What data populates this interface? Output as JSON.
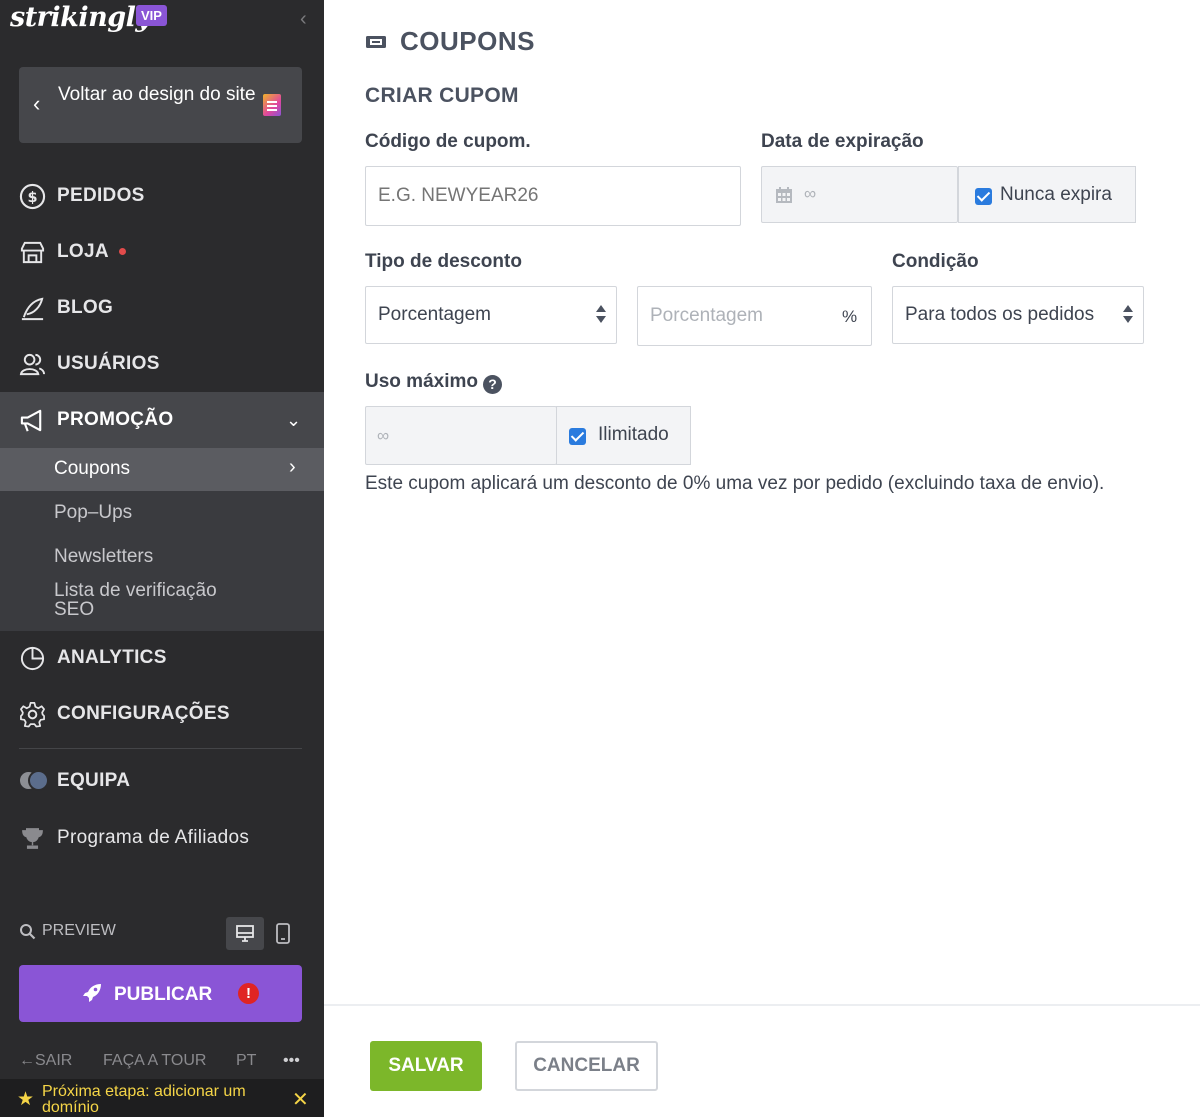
{
  "brand": {
    "logo": "strikingly",
    "badge": "VIP",
    "accent": "#8a55d6"
  },
  "sidebar": {
    "back_label": "Voltar ao design do site",
    "items": [
      {
        "label": "PEDIDOS",
        "icon": "dollar-circle-icon"
      },
      {
        "label": "LOJA",
        "icon": "store-icon"
      },
      {
        "label": "BLOG",
        "icon": "feather-pen-icon"
      },
      {
        "label": "USUÁRIOS",
        "icon": "users-icon"
      },
      {
        "label": "PROMOÇÃO",
        "icon": "megaphone-icon"
      },
      {
        "label": "ANALYTICS",
        "icon": "pie-chart-icon"
      },
      {
        "label": "CONFIGURAÇÕES",
        "icon": "gear-icon"
      },
      {
        "label": "EQUIPA",
        "icon": "team-avatars-icon"
      },
      {
        "label": "Programa de Afiliados",
        "icon": "trophy-icon"
      }
    ],
    "promo_sub": [
      "Coupons",
      "Pop–Ups",
      "Newsletters",
      "Lista de verificação SEO"
    ],
    "preview_label": "PREVIEW",
    "publish_label": "PUBLICAR",
    "publish_alert": "!",
    "footer": {
      "exit": "SAIR",
      "tour": "FAÇA A TOUR",
      "lang": "PT",
      "more": "•••"
    },
    "next_step": "Próxima etapa: adicionar um domínio"
  },
  "main": {
    "title": "COUPONS",
    "section": "CRIAR CUPOM",
    "code_label": "Código de cupom.",
    "code_placeholder": "E.G. NEWYEAR26",
    "expiry_label": "Data de expiração",
    "expiry_value": "∞",
    "never_expires": "Nunca expira",
    "discount_type_label": "Tipo de desconto",
    "discount_type_value": "Porcentagem",
    "discount_placeholder": "Porcentagem",
    "discount_unit": "%",
    "condition_label": "Condição",
    "condition_value": "Para todos os pedidos",
    "max_use_label": "Uso máximo",
    "max_use_help": "?",
    "max_use_value": "∞",
    "unlimited_label": "Ilimitado",
    "description": "Este cupom aplicará um desconto de 0% uma vez por pedido (excluindo taxa de envio).",
    "save": "SALVAR",
    "cancel": "CANCELAR"
  }
}
